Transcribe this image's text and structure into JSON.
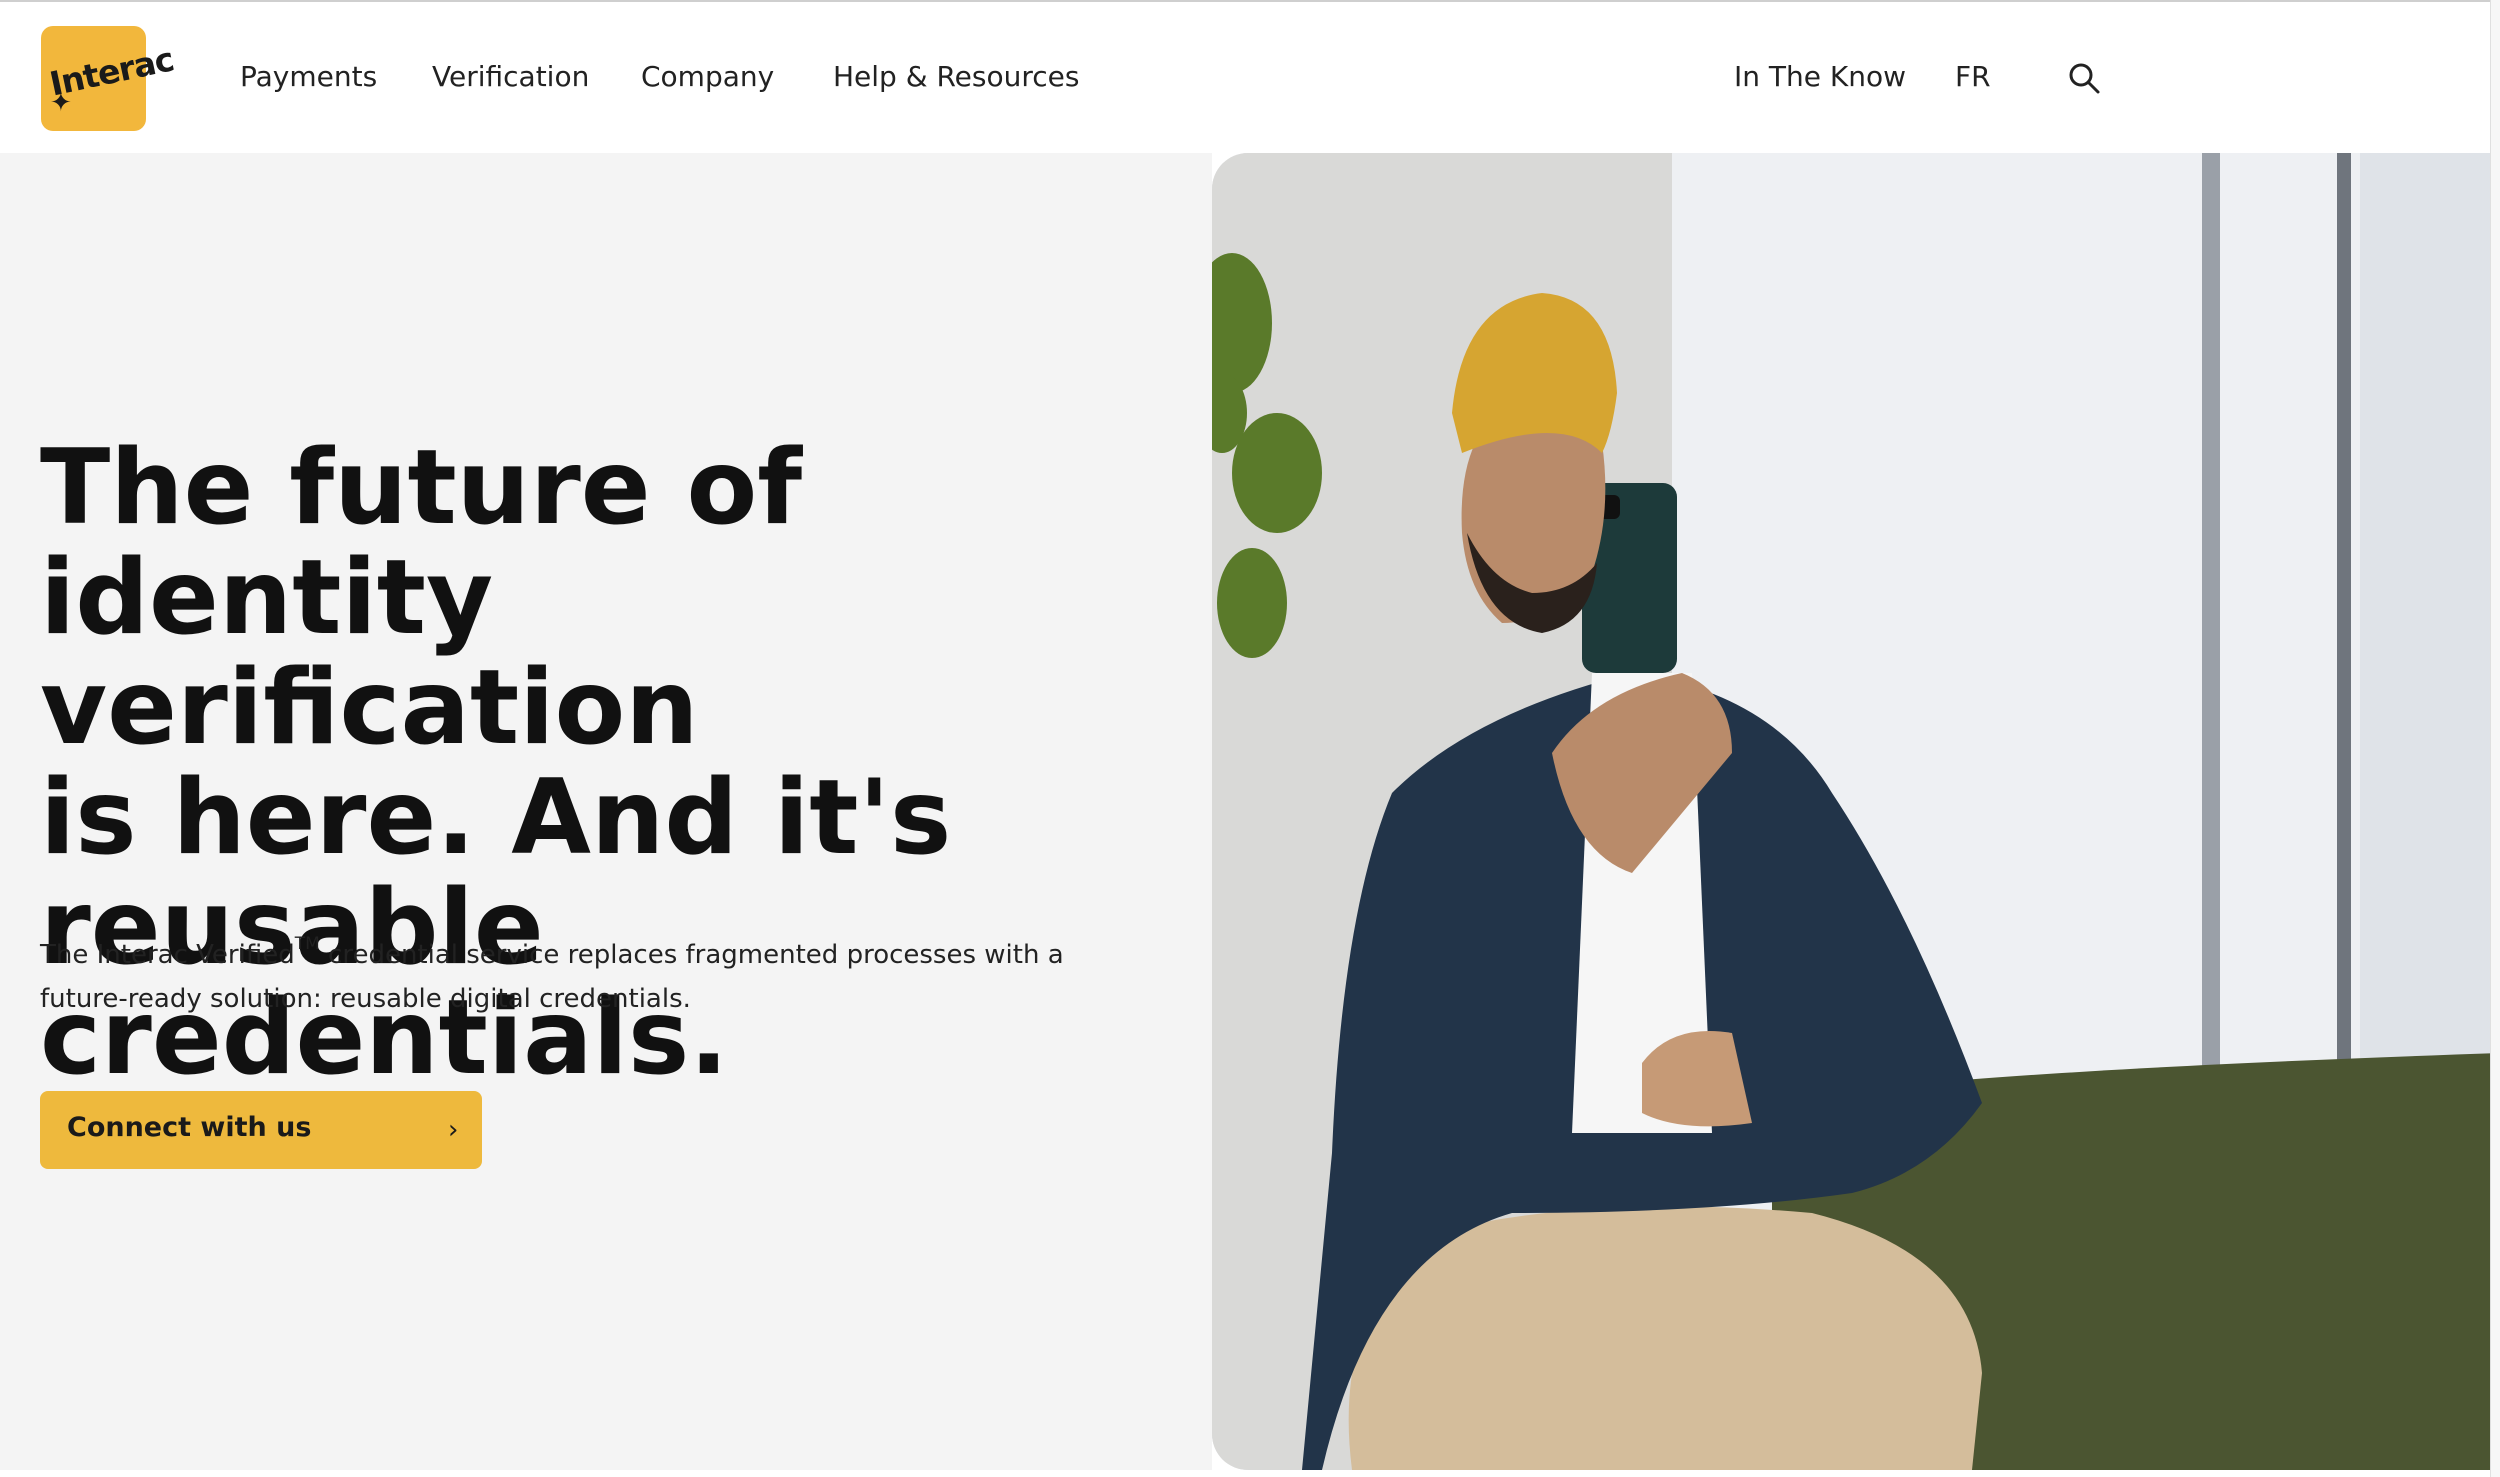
{
  "header": {
    "logo_text": "Interac",
    "nav_items": [
      {
        "label": "Payments"
      },
      {
        "label": "Verification"
      },
      {
        "label": "Company"
      },
      {
        "label": "Help & Resources"
      }
    ],
    "utility_items": [
      {
        "label": "In The Know"
      },
      {
        "label": "FR"
      }
    ],
    "search_icon": "search-icon"
  },
  "hero": {
    "headline_lines": [
      "The future of",
      "identity verification",
      "is here. And it's",
      "reusable credentials."
    ],
    "subcopy_before_tm": "The Interac Verified",
    "subcopy_tm": "TM",
    "subcopy_after_tm": " credential service replaces fragmented processes with a future-ready solution: reusable digital credentials.",
    "cta_label": "Connect with us",
    "cta_icon": "chevron-right-icon"
  },
  "colors": {
    "brand_yellow": "#f2b73c",
    "cta_yellow": "#eeb93d",
    "hero_background": "#f4f4f4",
    "text": "#111111"
  }
}
